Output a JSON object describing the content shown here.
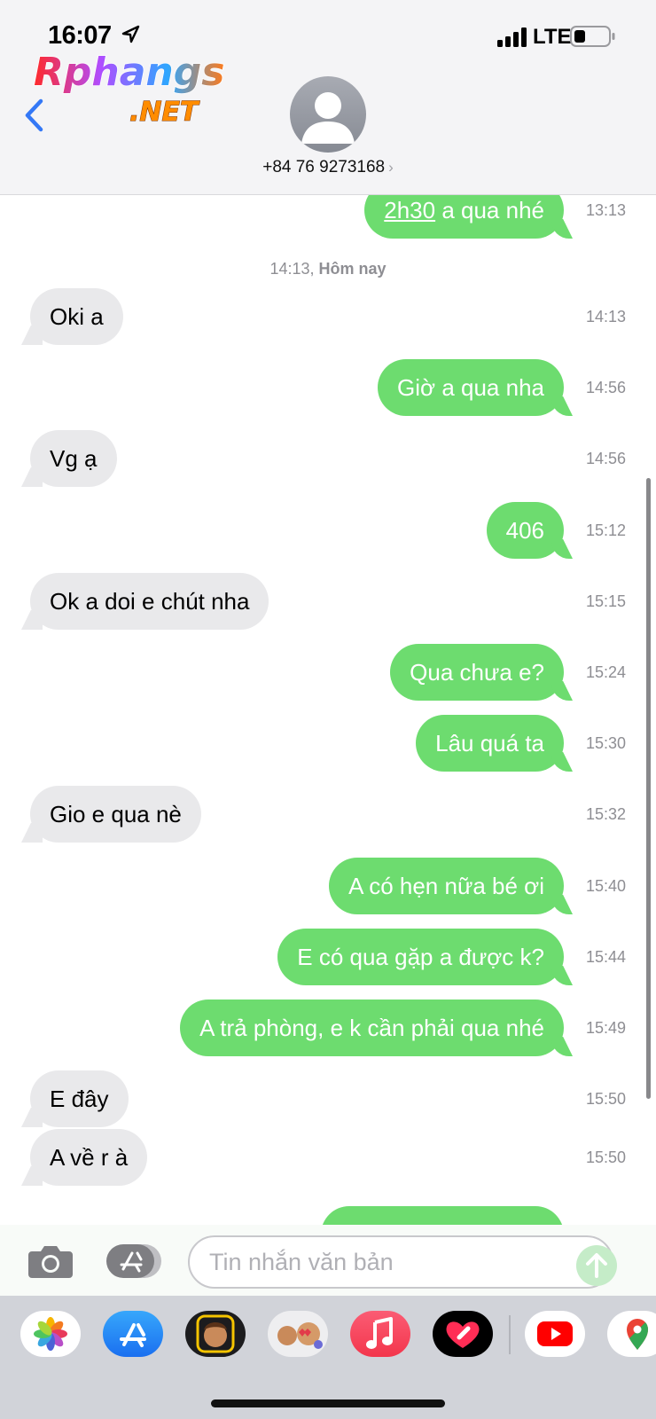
{
  "status_bar": {
    "time": "16:07",
    "network": "LTE",
    "icons": [
      "location-arrow-icon",
      "signal-bars-icon",
      "battery-icon"
    ]
  },
  "watermark": {
    "line1": "Rphangs",
    "line2": ".NET"
  },
  "header": {
    "contact_name": "+84 76 9273168",
    "chevron": "›",
    "back_icon": "chevron-left-icon",
    "avatar_icon": "person-silhouette-icon"
  },
  "thread": {
    "partial_top": {
      "link_text": "2h30",
      "rest_text": " a qua nhé",
      "time": "13:13"
    },
    "day_separator": {
      "time": "14:13,",
      "label": "Hôm nay"
    },
    "messages": [
      {
        "direction": "received",
        "text": "Oki a",
        "time": "14:13"
      },
      {
        "direction": "sent",
        "text": "Giờ a qua nha",
        "time": "14:56"
      },
      {
        "direction": "received",
        "text": "Vg ạ",
        "time": "14:56"
      },
      {
        "direction": "sent",
        "text": "406",
        "time": "15:12"
      },
      {
        "direction": "received",
        "text": "Ok a doi e chút nha",
        "time": "15:15"
      },
      {
        "direction": "sent",
        "text": "Qua chưa e?",
        "time": "15:24"
      },
      {
        "direction": "sent",
        "text": "Lâu quá ta",
        "time": "15:30"
      },
      {
        "direction": "received",
        "text": "Gio e qua nè",
        "time": "15:32"
      },
      {
        "direction": "sent",
        "text": "A có hẹn nữa bé ơi",
        "time": "15:40"
      },
      {
        "direction": "sent",
        "text": "E có qua gặp a được k?",
        "time": "15:44"
      },
      {
        "direction": "sent",
        "text": "A trả phòng, e k cần phải qua nhé",
        "time": "15:49"
      },
      {
        "direction": "received",
        "text": "E đây",
        "time": "15:50"
      },
      {
        "direction": "received",
        "text": "A về r à",
        "time": "15:50"
      }
    ]
  },
  "composer": {
    "placeholder": "Tin nhắn văn bản",
    "camera_icon": "camera-icon",
    "apps_icon": "app-store-icon",
    "send_icon": "arrow-up-icon"
  },
  "app_drawer": {
    "apps": [
      "photos",
      "app-store",
      "memoji-stickers",
      "animoji",
      "music",
      "digital-touch",
      "youtube",
      "google-maps"
    ]
  },
  "colors": {
    "sent_bubble": "#6ddc6f",
    "received_bubble": "#e9e9eb",
    "accent_blue": "#3478f6",
    "timestamp": "#8e8e93"
  }
}
